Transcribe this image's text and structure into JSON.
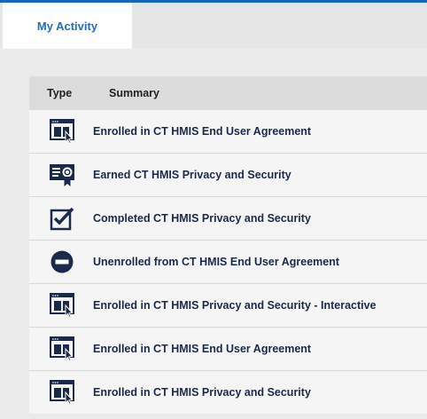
{
  "tabs": [
    {
      "label": "My Activity",
      "active": true
    }
  ],
  "table": {
    "headers": {
      "type": "Type",
      "summary": "Summary"
    },
    "rows": [
      {
        "icon": "enrolled-course-icon",
        "summary": "Enrolled in CT HMIS End User Agreement"
      },
      {
        "icon": "certificate-icon",
        "summary": "Earned CT HMIS Privacy and Security"
      },
      {
        "icon": "checked-box-icon",
        "summary": "Completed CT HMIS Privacy and Security"
      },
      {
        "icon": "unenrolled-minus-icon",
        "summary": "Unenrolled from CT HMIS End User Agreement"
      },
      {
        "icon": "enrolled-course-icon",
        "summary": "Enrolled in CT HMIS Privacy and Security - Interactive"
      },
      {
        "icon": "enrolled-course-icon",
        "summary": "Enrolled in CT HMIS End User Agreement"
      },
      {
        "icon": "enrolled-course-icon",
        "summary": "Enrolled in CT HMIS Privacy and Security"
      }
    ]
  },
  "colors": {
    "accent": "#1565c0",
    "icon": "#1b2a4a",
    "text": "#1b2a4a"
  }
}
